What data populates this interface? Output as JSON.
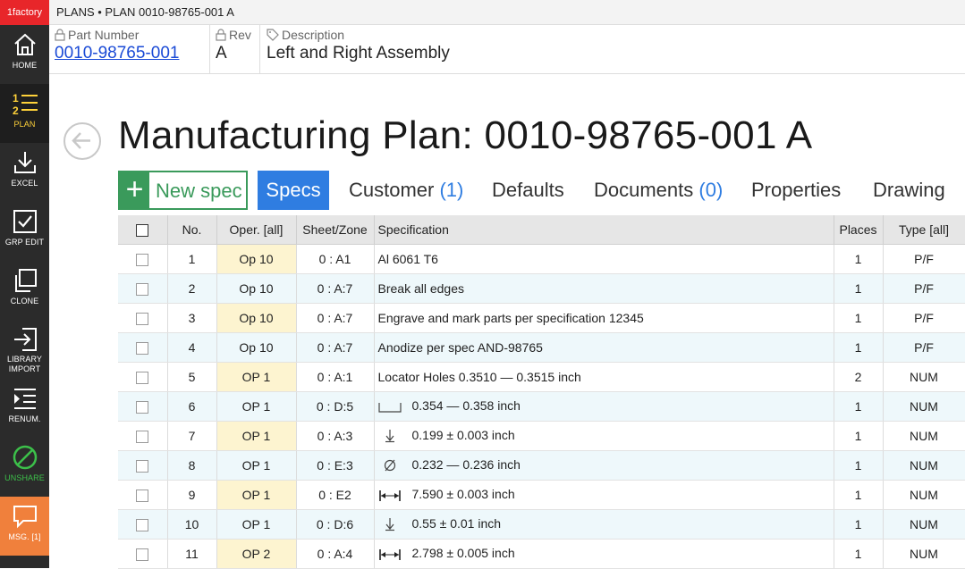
{
  "app": {
    "brand": "1factory"
  },
  "breadcrumb": "PLANS • PLAN 0010-98765-001 A",
  "sidebar": {
    "items": [
      {
        "label": "HOME",
        "icon": "home-icon"
      },
      {
        "label": "PLAN",
        "icon": "plan-list-icon"
      },
      {
        "label": "EXCEL",
        "icon": "download-icon"
      },
      {
        "label": "GRP EDIT",
        "icon": "checkbox-icon"
      },
      {
        "label": "CLONE",
        "icon": "clone-icon"
      },
      {
        "label": "LIBRARY",
        "label2": "IMPORT",
        "icon": "import-icon"
      },
      {
        "label": "RENUM.",
        "icon": "renumber-icon"
      },
      {
        "label": "UNSHARE",
        "icon": "unshare-icon"
      },
      {
        "label": "MSG. [1]",
        "icon": "message-icon"
      }
    ]
  },
  "header": {
    "part_number_label": "Part Number",
    "part_number": "0010-98765-001",
    "rev_label": "Rev",
    "rev": "A",
    "description_label": "Description",
    "description": "Left and Right Assembly"
  },
  "title": "Manufacturing Plan: 0010-98765-001 A",
  "tabs": {
    "new_spec": "New spec",
    "plus": "+",
    "specs": "Specs",
    "customer": "Customer",
    "customer_count": "(1)",
    "defaults": "Defaults",
    "documents": "Documents",
    "documents_count": "(0)",
    "properties": "Properties",
    "drawing": "Drawing"
  },
  "table": {
    "headers": [
      "No.",
      "Oper. [all]",
      "Sheet/Zone",
      "Specification",
      "Places",
      "Type [all]"
    ],
    "rows": [
      {
        "no": "1",
        "oper": "Op 10",
        "zone": "0 : A1",
        "spec": "Al 6061 T6",
        "symbol": "",
        "places": "1",
        "type": "P/F"
      },
      {
        "no": "2",
        "oper": "Op 10",
        "zone": "0 : A:7",
        "spec": "Break all edges",
        "symbol": "",
        "places": "1",
        "type": "P/F"
      },
      {
        "no": "3",
        "oper": "Op 10",
        "zone": "0 : A:7",
        "spec": "Engrave and mark parts per specification 12345",
        "symbol": "",
        "places": "1",
        "type": "P/F"
      },
      {
        "no": "4",
        "oper": "Op 10",
        "zone": "0 : A:7",
        "spec": "Anodize per spec AND-98765",
        "symbol": "",
        "places": "1",
        "type": "P/F"
      },
      {
        "no": "5",
        "oper": "OP 1",
        "zone": "0 : A:1",
        "spec": "Locator Holes   0.3510 — 0.3515  inch",
        "symbol": "",
        "places": "2",
        "type": "NUM"
      },
      {
        "no": "6",
        "oper": "OP 1",
        "zone": "0 : D:5",
        "spec": "0.354 — 0.358  inch",
        "symbol": "counterbore-icon",
        "places": "1",
        "type": "NUM"
      },
      {
        "no": "7",
        "oper": "OP 1",
        "zone": "0 : A:3",
        "spec": "0.199 ± 0.003  inch",
        "symbol": "depth-icon",
        "places": "1",
        "type": "NUM"
      },
      {
        "no": "8",
        "oper": "OP 1",
        "zone": "0 : E:3",
        "spec": "0.232 — 0.236  inch",
        "symbol": "diameter-icon",
        "places": "1",
        "type": "NUM"
      },
      {
        "no": "9",
        "oper": "OP 1",
        "zone": "0 : E2",
        "spec": "7.590 ± 0.003  inch",
        "symbol": "dimension-icon",
        "places": "1",
        "type": "NUM"
      },
      {
        "no": "10",
        "oper": "OP 1",
        "zone": "0 : D:6",
        "spec": "0.55 ± 0.01  inch",
        "symbol": "depth-icon",
        "places": "1",
        "type": "NUM"
      },
      {
        "no": "11",
        "oper": "OP 2",
        "zone": "0 : A:4",
        "spec": "2.798 ± 0.005  inch",
        "symbol": "dimension-icon",
        "places": "1",
        "type": "NUM"
      }
    ]
  },
  "colors": {
    "brand": "#e8262a",
    "sidebar": "#2b2b2b",
    "accent_blue": "#2f7de1",
    "accent_green": "#3a9a5b",
    "active_yellow": "#ffd23a",
    "msg_orange": "#f0803c",
    "op_cell": "#fdf4d0",
    "alt_row": "#eef8fb"
  }
}
